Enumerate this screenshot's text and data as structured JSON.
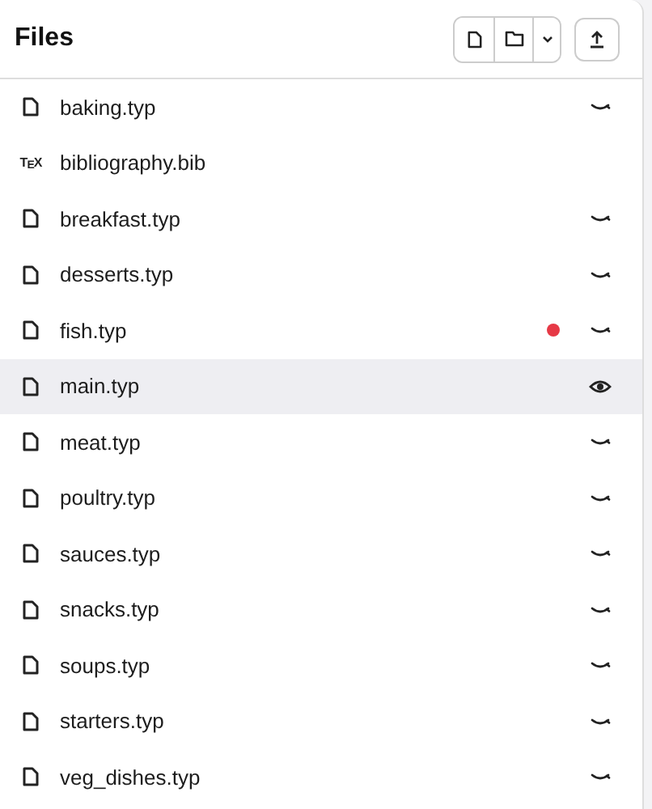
{
  "panel": {
    "title": "Files"
  },
  "files": [
    {
      "name": "baking.typ",
      "kind": "typ",
      "selected": false,
      "unsaved": false,
      "previewed": false
    },
    {
      "name": "bibliography.bib",
      "kind": "tex",
      "badge": "T$_{E}$X",
      "selected": false,
      "unsaved": false
    },
    {
      "name": "breakfast.typ",
      "kind": "typ",
      "selected": false,
      "unsaved": false,
      "previewed": false
    },
    {
      "name": "desserts.typ",
      "kind": "typ",
      "selected": false,
      "unsaved": false,
      "previewed": false
    },
    {
      "name": "fish.typ",
      "kind": "typ",
      "selected": false,
      "unsaved": true,
      "previewed": false
    },
    {
      "name": "main.typ",
      "kind": "typ",
      "selected": true,
      "unsaved": false,
      "previewed": true
    },
    {
      "name": "meat.typ",
      "kind": "typ",
      "selected": false,
      "unsaved": false,
      "previewed": false
    },
    {
      "name": "poultry.typ",
      "kind": "typ",
      "selected": false,
      "unsaved": false,
      "previewed": false
    },
    {
      "name": "sauces.typ",
      "kind": "typ",
      "selected": false,
      "unsaved": false,
      "previewed": false
    },
    {
      "name": "snacks.typ",
      "kind": "typ",
      "selected": false,
      "unsaved": false,
      "previewed": false
    },
    {
      "name": "soups.typ",
      "kind": "typ",
      "selected": false,
      "unsaved": false,
      "previewed": false
    },
    {
      "name": "starters.typ",
      "kind": "typ",
      "selected": false,
      "unsaved": false,
      "previewed": false
    },
    {
      "name": "veg_dishes.typ",
      "kind": "typ",
      "selected": false,
      "unsaved": false,
      "previewed": false
    }
  ]
}
